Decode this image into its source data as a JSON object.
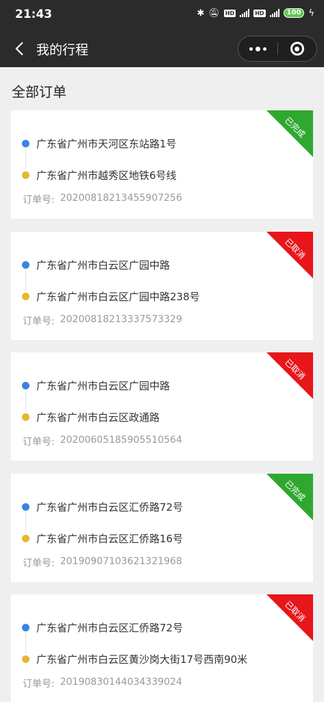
{
  "status_bar": {
    "time": "21:43",
    "battery": "100"
  },
  "nav": {
    "title": "我的行程"
  },
  "section_title": "全部订单",
  "order_label": "订单号:",
  "colors": {
    "completed": "#2fa82f",
    "cancelled": "#e8151b"
  },
  "orders": [
    {
      "from": "广东省广州市天河区东站路1号",
      "to": "广东省广州市越秀区地铁6号线",
      "order_no": "20200818213455907256",
      "status": "已完成",
      "status_type": "completed"
    },
    {
      "from": "广东省广州市白云区广园中路",
      "to": "广东省广州市白云区广园中路238号",
      "order_no": "20200818213337573329",
      "status": "已取消",
      "status_type": "cancelled"
    },
    {
      "from": "广东省广州市白云区广园中路",
      "to": "广东省广州市白云区政通路",
      "order_no": "20200605185905510564",
      "status": "已取消",
      "status_type": "cancelled"
    },
    {
      "from": "广东省广州市白云区汇侨路72号",
      "to": "广东省广州市白云区汇侨路16号",
      "order_no": "20190907103621321968",
      "status": "已完成",
      "status_type": "completed"
    },
    {
      "from": "广东省广州市白云区汇侨路72号",
      "to": "广东省广州市白云区黄沙岗大街17号西南90米",
      "order_no": "20190830144034339024",
      "status": "已取消",
      "status_type": "cancelled"
    }
  ]
}
